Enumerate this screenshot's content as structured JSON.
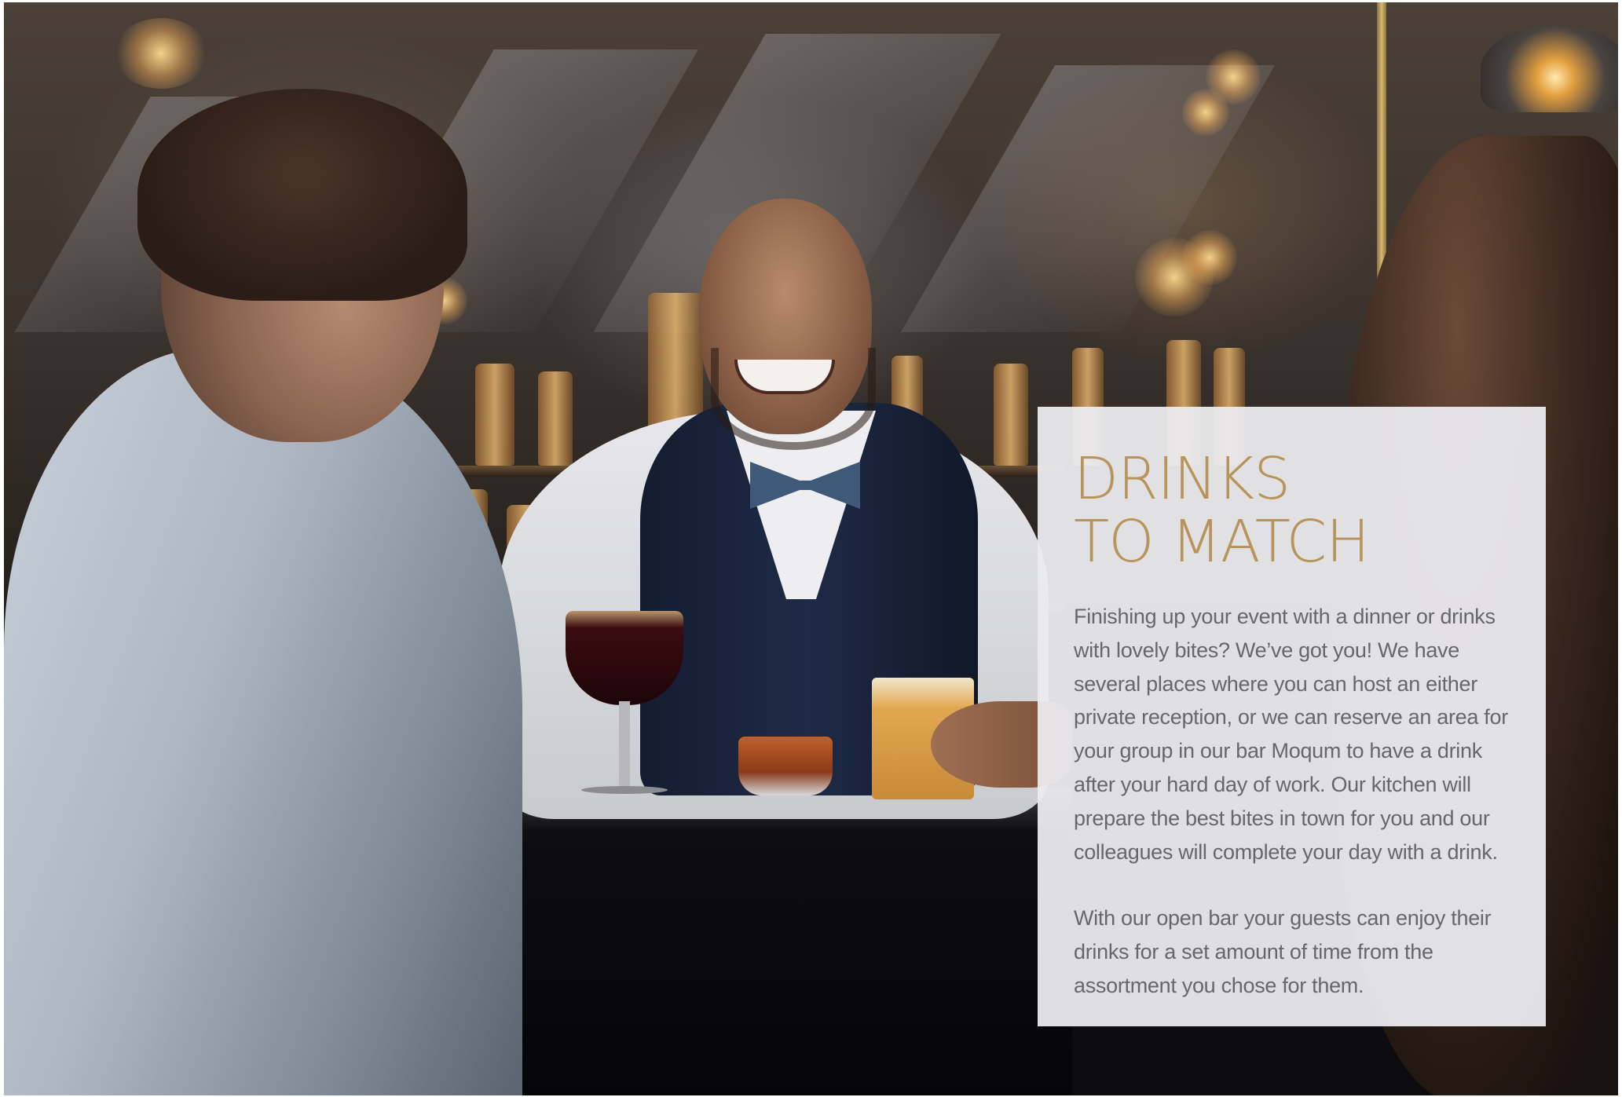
{
  "panel": {
    "title_line1": "DRINKS",
    "title_line2": "TO MATCH",
    "paragraph1": "Finishing up your event with a dinner or drinks with lovely bites? We’ve got you! We have several places where you can host an either private reception, or we can reserve an area for your group in our bar Moqum to have a drink after your hard day of work. Our kitchen will prepare the best bites in town for you and our colleagues will complete your day with a drink.",
    "paragraph2": "With our open bar your guests can enjoy their drinks for a set amount of time from the assortment you chose for them."
  },
  "colors": {
    "title": "#b8945a",
    "body_text": "#66666c",
    "panel_background": "#ebebee"
  }
}
